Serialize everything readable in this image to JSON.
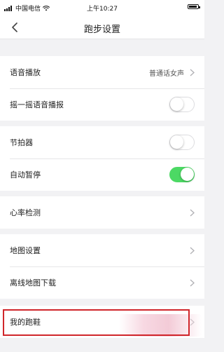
{
  "status_bar": {
    "carrier": "中国电信",
    "time": "上午10:27"
  },
  "nav": {
    "title": "跑步设置"
  },
  "settings": {
    "voice_broadcast": {
      "label": "语音播放",
      "value": "普通话女声"
    },
    "shake_voice": {
      "label": "摇一摇语音播报",
      "enabled": false
    },
    "metronome": {
      "label": "节拍器",
      "enabled": false
    },
    "auto_pause": {
      "label": "自动暂停",
      "enabled": true
    },
    "heart_rate": {
      "label": "心率检测"
    },
    "map_settings": {
      "label": "地图设置"
    },
    "offline_map": {
      "label": "离线地图下载"
    },
    "my_shoes": {
      "label": "我的跑鞋"
    }
  },
  "colors": {
    "toggle_on": "#4cd964",
    "highlight": "#d0262b"
  }
}
